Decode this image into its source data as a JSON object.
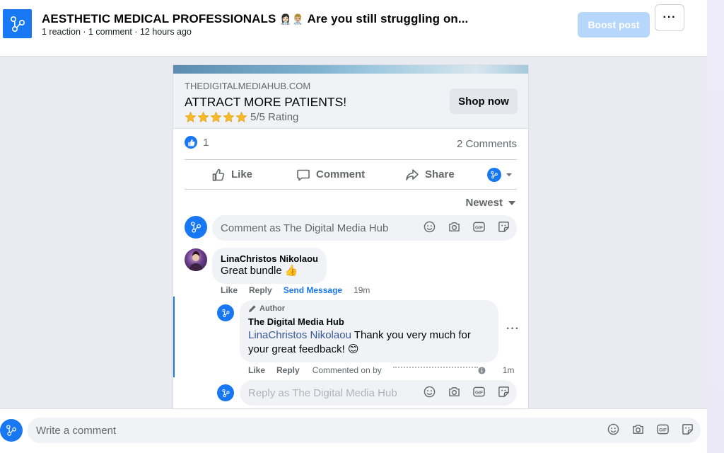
{
  "header": {
    "title": "AESTHETIC MEDICAL PROFESSIONALS",
    "title_emoji": "👩🏻‍⚕️👨🏼‍⚕️",
    "title_rest": "Are you still struggling on...",
    "meta": "1 reaction · 1 comment · 12 hours ago",
    "boost_label": "Boost post",
    "more_label": "···"
  },
  "ad": {
    "domain": "THEDIGITALMEDIAHUB.COM",
    "headline": "ATTRACT MORE PATIENTS!",
    "rating": 5,
    "rating_text": "5/5 Rating",
    "cta_label": "Shop now"
  },
  "stats": {
    "reaction_count": "1",
    "comments_label": "2 Comments"
  },
  "actions": {
    "like": "Like",
    "comment": "Comment",
    "share": "Share"
  },
  "sort": {
    "label": "Newest"
  },
  "comment_box": {
    "placeholder": "Comment as The Digital Media Hub"
  },
  "comments": [
    {
      "author": "LinaChristos Nikolaou",
      "text": "Great bundle 👍",
      "actions": [
        "Like",
        "Reply",
        "Send Message"
      ],
      "time": "19m",
      "reply": {
        "badge": "Author",
        "author": "The Digital Media Hub",
        "mention": "LinaChristos Nikolaou",
        "text": " Thank you very much for your great feedback! 😊",
        "actions": [
          "Like",
          "Reply"
        ],
        "commented_on_by": "Commented on by",
        "time": "1m"
      }
    }
  ],
  "reply_box": {
    "placeholder": "Reply as The Digital Media Hub"
  },
  "bottom": {
    "placeholder": "Write a comment"
  },
  "colors": {
    "brand": "#1877f2",
    "boost_disabled": "#b6d6fb",
    "mention": "#385898",
    "star": "#f7b928"
  },
  "icons": [
    "page-logo-icon",
    "thumbs-up-icon",
    "comment-icon",
    "share-icon",
    "smiley-icon",
    "camera-icon",
    "gif-icon",
    "sticker-icon",
    "chevron-down-icon",
    "pencil-icon",
    "info-icon",
    "star-icon"
  ]
}
